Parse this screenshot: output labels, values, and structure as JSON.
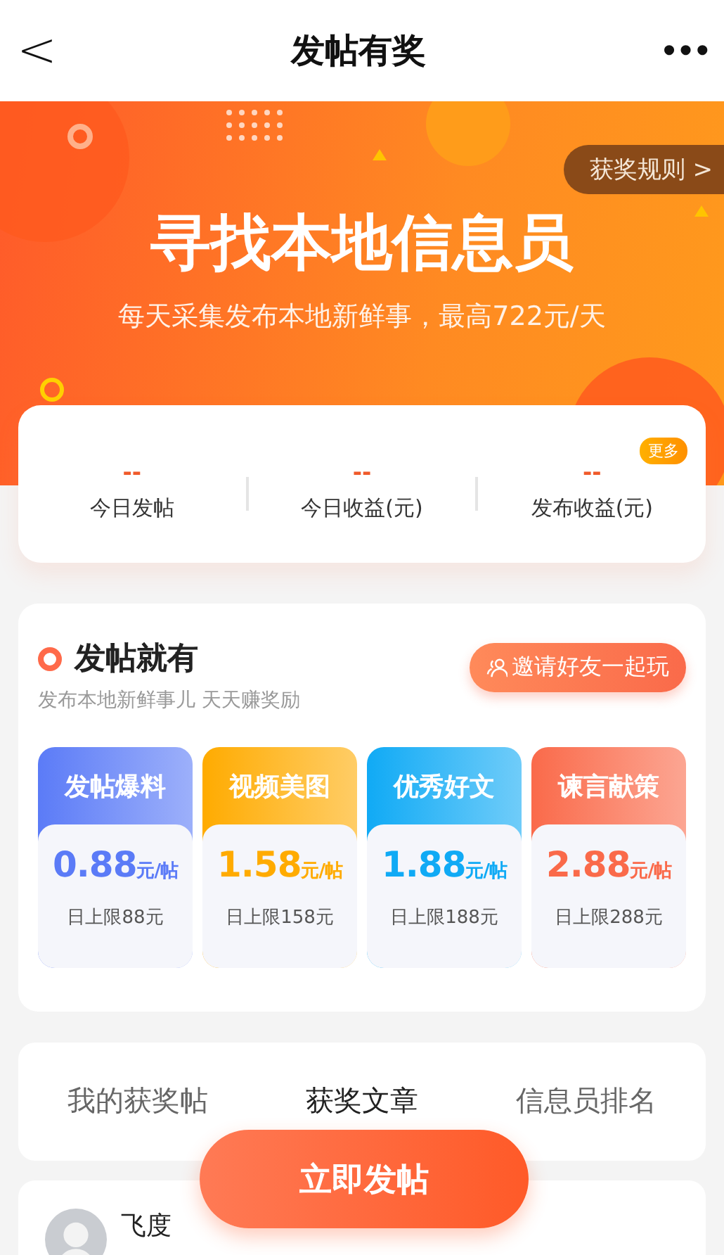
{
  "header": {
    "back": "<",
    "title": "发帖有奖",
    "more": "•••"
  },
  "banner": {
    "title": "寻找本地信息员",
    "subtitle": "每天采集发布本地新鲜事，最高722元/天",
    "rules_button": "获奖规则 >"
  },
  "stats": {
    "more_badge": "更多",
    "items": [
      {
        "value": "--",
        "label": "今日发帖"
      },
      {
        "value": "--",
        "label": "今日收益(元)"
      },
      {
        "value": "--",
        "label": "发布收益(元)"
      }
    ]
  },
  "reward_section": {
    "title": "发帖就有",
    "subtitle": "发布本地新鲜事儿 天天赚奖励",
    "invite_button": "邀请好友一起玩",
    "categories": [
      {
        "name": "发帖爆料",
        "price": "0.88",
        "unit": "元/帖",
        "limit": "日上限88元",
        "color": "#5b7bf7"
      },
      {
        "name": "视频美图",
        "price": "1.58",
        "unit": "元/帖",
        "limit": "日上限158元",
        "color": "#ffab00"
      },
      {
        "name": "优秀好文",
        "price": "1.88",
        "unit": "元/帖",
        "limit": "日上限188元",
        "color": "#10aaf5"
      },
      {
        "name": "谏言献策",
        "price": "2.88",
        "unit": "元/帖",
        "limit": "日上限288元",
        "color": "#fa6a4a"
      }
    ]
  },
  "tabs": [
    {
      "label": "我的获奖帖",
      "selected": false
    },
    {
      "label": "获奖文章",
      "selected": true
    },
    {
      "label": "信息员排名",
      "selected": false
    }
  ],
  "post": {
    "author": "飞度"
  },
  "post_button": "立即发帖"
}
